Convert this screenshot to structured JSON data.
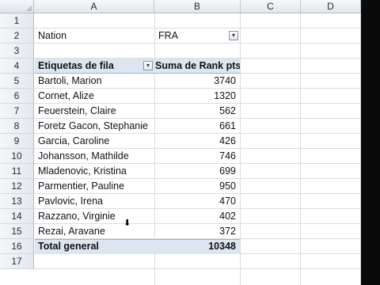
{
  "columns": [
    "A",
    "B",
    "C",
    "D"
  ],
  "rows": [
    "1",
    "2",
    "3",
    "4",
    "5",
    "6",
    "7",
    "8",
    "9",
    "10",
    "11",
    "12",
    "13",
    "14",
    "15",
    "16",
    "17"
  ],
  "filter": {
    "label": "Nation",
    "value": "FRA"
  },
  "pivot": {
    "row_label_header": "Etiquetas de fila",
    "value_header": "Suma de Rank pts",
    "rows": [
      {
        "name": "Bartoli, Marion",
        "value": "3740"
      },
      {
        "name": "Cornet, Alize",
        "value": "1320"
      },
      {
        "name": "Feuerstein, Claire",
        "value": "562"
      },
      {
        "name": "Foretz Gacon, Stephanie",
        "value": "661"
      },
      {
        "name": "Garcia, Caroline",
        "value": "426"
      },
      {
        "name": "Johansson, Mathilde",
        "value": "746"
      },
      {
        "name": "Mladenovic, Kristina",
        "value": "699"
      },
      {
        "name": "Parmentier, Pauline",
        "value": "950"
      },
      {
        "name": "Pavlovic, Irena",
        "value": "470"
      },
      {
        "name": "Razzano, Virginie",
        "value": "402"
      },
      {
        "name": "Rezai, Aravane",
        "value": "372"
      }
    ],
    "total_label": "Total general",
    "total_value": "10348"
  },
  "icons": {
    "filter_dropdown": "filter-funnel-icon",
    "row_dropdown": "dropdown-arrow-icon",
    "cursor": "mouse-cursor-icon"
  }
}
